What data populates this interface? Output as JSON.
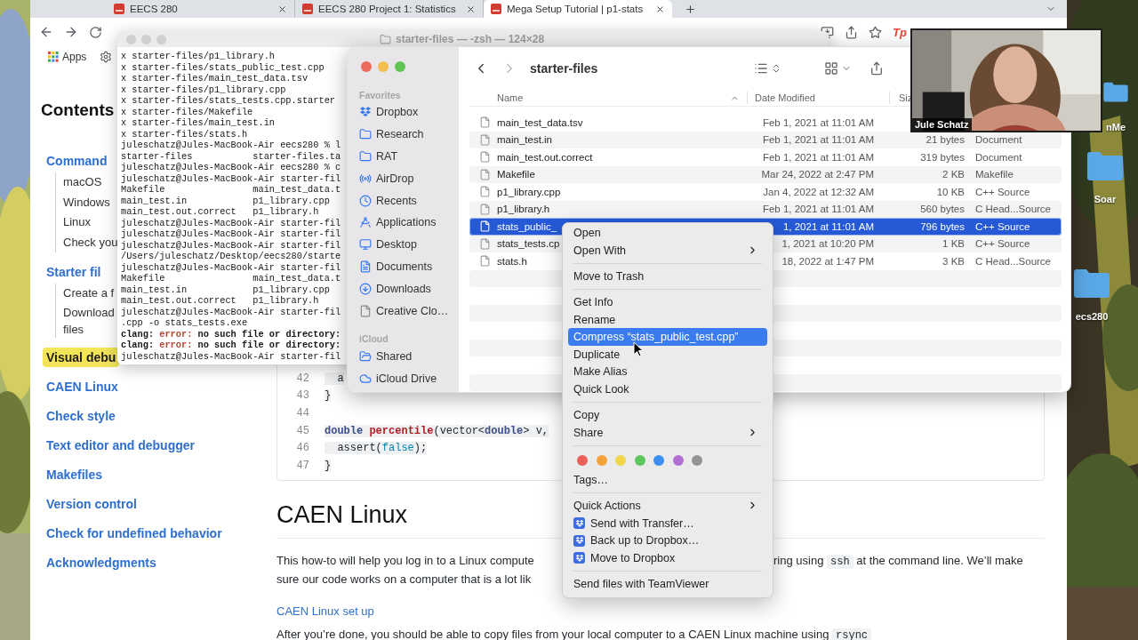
{
  "desktop": {
    "icons": [
      {
        "label": "nMe"
      },
      {
        "label": "Soar"
      },
      {
        "label": "ecs280"
      }
    ]
  },
  "browser": {
    "tabs": [
      {
        "title": "EECS 280",
        "selected": false
      },
      {
        "title": "EECS 280 Project 1: Statistics",
        "selected": false
      },
      {
        "title": "Mega Setup Tutorial | p1-stats",
        "selected": true
      }
    ],
    "bookmarks": [
      {
        "label": "Apps"
      }
    ],
    "extension": "Tp",
    "contents": {
      "title": "Contents",
      "items": [
        {
          "label": "Command",
          "selected": false,
          "children": [
            {
              "label": "macOS",
              "selected": false
            },
            {
              "label": "Windows",
              "selected": false
            },
            {
              "label": "Linux",
              "selected": false
            },
            {
              "label": "Check you",
              "selected": false
            }
          ]
        },
        {
          "label": "Starter fil",
          "selected": false,
          "children": [
            {
              "label": "Create a f",
              "selected": false
            },
            {
              "lines": [
                "Download",
                "files"
              ],
              "selected": false
            }
          ]
        },
        {
          "label": "Visual debu",
          "selected": true
        },
        {
          "label": "CAEN Linux",
          "selected": false
        },
        {
          "label": "Check style",
          "selected": false
        },
        {
          "label": "Text editor and debugger",
          "selected": false
        },
        {
          "label": "Makefiles",
          "selected": false
        },
        {
          "label": "Version control",
          "selected": false
        },
        {
          "label": "Check for undefined behavior",
          "selected": false
        },
        {
          "label": "Acknowledgments",
          "selected": false
        }
      ]
    },
    "code": {
      "lines": [
        {
          "number": "42",
          "segments": [
            {
              "kind": "plain",
              "text": "  a"
            }
          ]
        },
        {
          "number": "43",
          "segments": [
            {
              "kind": "plain",
              "text": "}"
            }
          ]
        },
        {
          "number": "44"
        },
        {
          "number": "45",
          "segments": [
            {
              "kind": "keyword",
              "text": "double "
            },
            {
              "kind": "function",
              "text": "percentile"
            },
            {
              "kind": "plain",
              "text": "(vector<"
            },
            {
              "kind": "keyword",
              "text": "double"
            },
            {
              "kind": "plain",
              "text": "> v,"
            }
          ]
        },
        {
          "number": "46",
          "segments": [
            {
              "kind": "plain",
              "text": "  assert("
            },
            {
              "kind": "literal",
              "text": "false"
            },
            {
              "kind": "plain",
              "text": ");"
            }
          ]
        },
        {
          "number": "47",
          "segments": [
            {
              "kind": "plain",
              "text": "}"
            }
          ]
        }
      ]
    },
    "section": {
      "heading": "CAEN Linux",
      "paragraph_left": [
        "This how-to will help you log in to a Linux compute",
        "sure our code works on a computer that is a lot lik"
      ],
      "paragraph_right": [
        {
          "kind": "text",
          "text": "ring using "
        },
        {
          "kind": "code",
          "text": "ssh"
        },
        {
          "kind": "text",
          "text": " at the command line. We’ll make"
        }
      ],
      "link": "CAEN Linux set up",
      "last_line": [
        {
          "kind": "text",
          "text": "After you’re done, you should be able to copy files from your local computer to a CAEN Linux machine using "
        },
        {
          "kind": "code",
          "text": "rsync"
        }
      ]
    }
  },
  "terminal": {
    "title": "starter-files — -zsh — 124×28",
    "lines": [
      {
        "text": "x starter-files/p1_library.h"
      },
      {
        "text": "x starter-files/stats_public_test.cpp"
      },
      {
        "text": "x starter-files/main_test_data.tsv"
      },
      {
        "text": "x starter-files/p1_library.cpp"
      },
      {
        "text": "x starter-files/stats_tests.cpp.starter"
      },
      {
        "text": "x starter-files/Makefile"
      },
      {
        "text": "x starter-files/main_test.in"
      },
      {
        "text": "x starter-files/stats.h"
      },
      {
        "text": "juleschatz@Jules-MacBook-Air eecs280 % l"
      },
      {
        "text": "starter-files           starter-files.ta"
      },
      {
        "text": "juleschatz@Jules-MacBook-Air eecs280 % c"
      },
      {
        "text": "juleschatz@Jules-MacBook-Air starter-fil"
      },
      {
        "text": "Makefile                main_test_data.t"
      },
      {
        "text": "main_test.in            p1_library.cpp"
      },
      {
        "text": "main_test.out.correct   p1_library.h"
      },
      {
        "text": "juleschatz@Jules-MacBook-Air starter-fil"
      },
      {
        "text": "juleschatz@Jules-MacBook-Air starter-fil"
      },
      {
        "text": "juleschatz@Jules-MacBook-Air starter-fil"
      },
      {
        "text": "/Users/juleschatz/Desktop/eecs280/starte"
      },
      {
        "text": "juleschatz@Jules-MacBook-Air starter-fil"
      },
      {
        "text": "Makefile                main_test_data.t"
      },
      {
        "text": "main_test.in            p1_library.cpp"
      },
      {
        "text": "main_test.out.correct   p1_library.h"
      },
      {
        "text": "juleschatz@Jules-MacBook-Air starter-fil"
      },
      {
        "text": ".cpp -o stats_tests.exe"
      },
      {
        "parts": [
          {
            "kind": "bold",
            "text": "clang: "
          },
          {
            "kind": "error",
            "text": "error:"
          },
          {
            "kind": "bold",
            "text": " no such file or directory:"
          }
        ]
      },
      {
        "parts": [
          {
            "kind": "bold",
            "text": "clang: "
          },
          {
            "kind": "error",
            "text": "error:"
          },
          {
            "kind": "bold",
            "text": " no such file or directory:"
          }
        ]
      },
      {
        "text": "juleschatz@Jules-MacBook-Air starter-fil"
      }
    ]
  },
  "finder": {
    "title": "starter-files",
    "sidebar": [
      {
        "title": "Favorites",
        "items": [
          {
            "label": "Dropbox",
            "kind": "dropbox"
          },
          {
            "label": "Research",
            "kind": "folder"
          },
          {
            "label": "RAT",
            "kind": "folder"
          },
          {
            "label": "AirDrop",
            "kind": "airdrop"
          },
          {
            "label": "Recents",
            "kind": "recents"
          },
          {
            "label": "Applications",
            "kind": "applications"
          },
          {
            "label": "Desktop",
            "kind": "desktop"
          },
          {
            "label": "Documents",
            "kind": "documents"
          },
          {
            "label": "Downloads",
            "kind": "downloads"
          },
          {
            "label": "Creative Clo…",
            "kind": "file"
          }
        ]
      },
      {
        "title": "iCloud",
        "items": [
          {
            "label": "Shared",
            "kind": "shared"
          },
          {
            "label": "iCloud Drive",
            "kind": "cloud"
          }
        ]
      }
    ],
    "columns": [
      "Name",
      "Date Modified",
      "Siz"
    ],
    "rows": [
      {
        "name": "main_test_data.tsv",
        "date": "Feb 1, 2021 at 11:01 AM",
        "selected": false
      },
      {
        "name": "main_test.in",
        "date": "Feb 1, 2021 at 11:01 AM",
        "size": "21 bytes",
        "type": "Document",
        "selected": false
      },
      {
        "name": "main_test.out.correct",
        "date": "Feb 1, 2021 at 11:01 AM",
        "size": "319 bytes",
        "type": "Document",
        "selected": false
      },
      {
        "name": "Makefile",
        "date": "Mar 24, 2022 at 2:47 PM",
        "size": "2 KB",
        "type": "Makefile",
        "selected": false
      },
      {
        "name": "p1_library.cpp",
        "date": "Jan 4, 2022 at 12:32 AM",
        "size": "10 KB",
        "type": "C++ Source",
        "selected": false
      },
      {
        "name": "p1_library.h",
        "date": "Feb 1, 2021 at 11:01 AM",
        "size": "560 bytes",
        "type": "C Head...Source",
        "selected": false
      },
      {
        "name": "stats_public_",
        "date": "1, 2021 at 11:01 AM",
        "size": "796 bytes",
        "type": "C++ Source",
        "selected": true
      },
      {
        "name": "stats_tests.cp",
        "date": "1, 2021 at 10:20 PM",
        "size": "1 KB",
        "type": "C++ Source",
        "selected": false
      },
      {
        "name": "stats.h",
        "date": "18, 2022 at 1:47 PM",
        "size": "3 KB",
        "type": "C Head...Source",
        "selected": false
      }
    ]
  },
  "context_menu": {
    "items": [
      {
        "kind": "item",
        "label": "Open",
        "submenu": false,
        "selected": false
      },
      {
        "kind": "item",
        "label": "Open With",
        "submenu": true,
        "selected": false
      },
      {
        "kind": "separator"
      },
      {
        "kind": "item",
        "label": "Move to Trash",
        "submenu": false,
        "selected": false
      },
      {
        "kind": "separator"
      },
      {
        "kind": "item",
        "label": "Get Info",
        "submenu": false,
        "selected": false
      },
      {
        "kind": "item",
        "label": "Rename",
        "submenu": false,
        "selected": false
      },
      {
        "kind": "item",
        "label": "Compress “stats_public_test.cpp”",
        "submenu": false,
        "selected": true
      },
      {
        "kind": "item",
        "label": "Duplicate",
        "submenu": false,
        "selected": false
      },
      {
        "kind": "item",
        "label": "Make Alias",
        "submenu": false,
        "selected": false
      },
      {
        "kind": "item",
        "label": "Quick Look",
        "submenu": false,
        "selected": false
      },
      {
        "kind": "separator"
      },
      {
        "kind": "item",
        "label": "Copy",
        "submenu": false,
        "selected": false
      },
      {
        "kind": "item",
        "label": "Share",
        "submenu": true,
        "selected": false
      },
      {
        "kind": "separator"
      },
      {
        "kind": "colors",
        "colors": [
          {
            "color": "#ec5f5a"
          },
          {
            "color": "#f4a23b"
          },
          {
            "color": "#f2d64b"
          },
          {
            "color": "#5cc55b"
          },
          {
            "color": "#3b8ef0"
          },
          {
            "color": "#b36fd6"
          },
          {
            "color": "#959595"
          }
        ]
      },
      {
        "kind": "item",
        "label": "Tags…",
        "submenu": false,
        "selected": false
      },
      {
        "kind": "separator"
      },
      {
        "kind": "item",
        "label": "Quick Actions",
        "submenu": true,
        "selected": false
      },
      {
        "kind": "action",
        "label": "Send with Transfer…",
        "selected": false
      },
      {
        "kind": "action",
        "label": "Back up to Dropbox…",
        "selected": false
      },
      {
        "kind": "action",
        "label": "Move to Dropbox",
        "selected": false
      },
      {
        "kind": "separator"
      },
      {
        "kind": "item",
        "label": "Send files with TeamViewer",
        "submenu": false,
        "selected": false
      }
    ]
  },
  "video": {
    "name": "Jule Schatz"
  }
}
